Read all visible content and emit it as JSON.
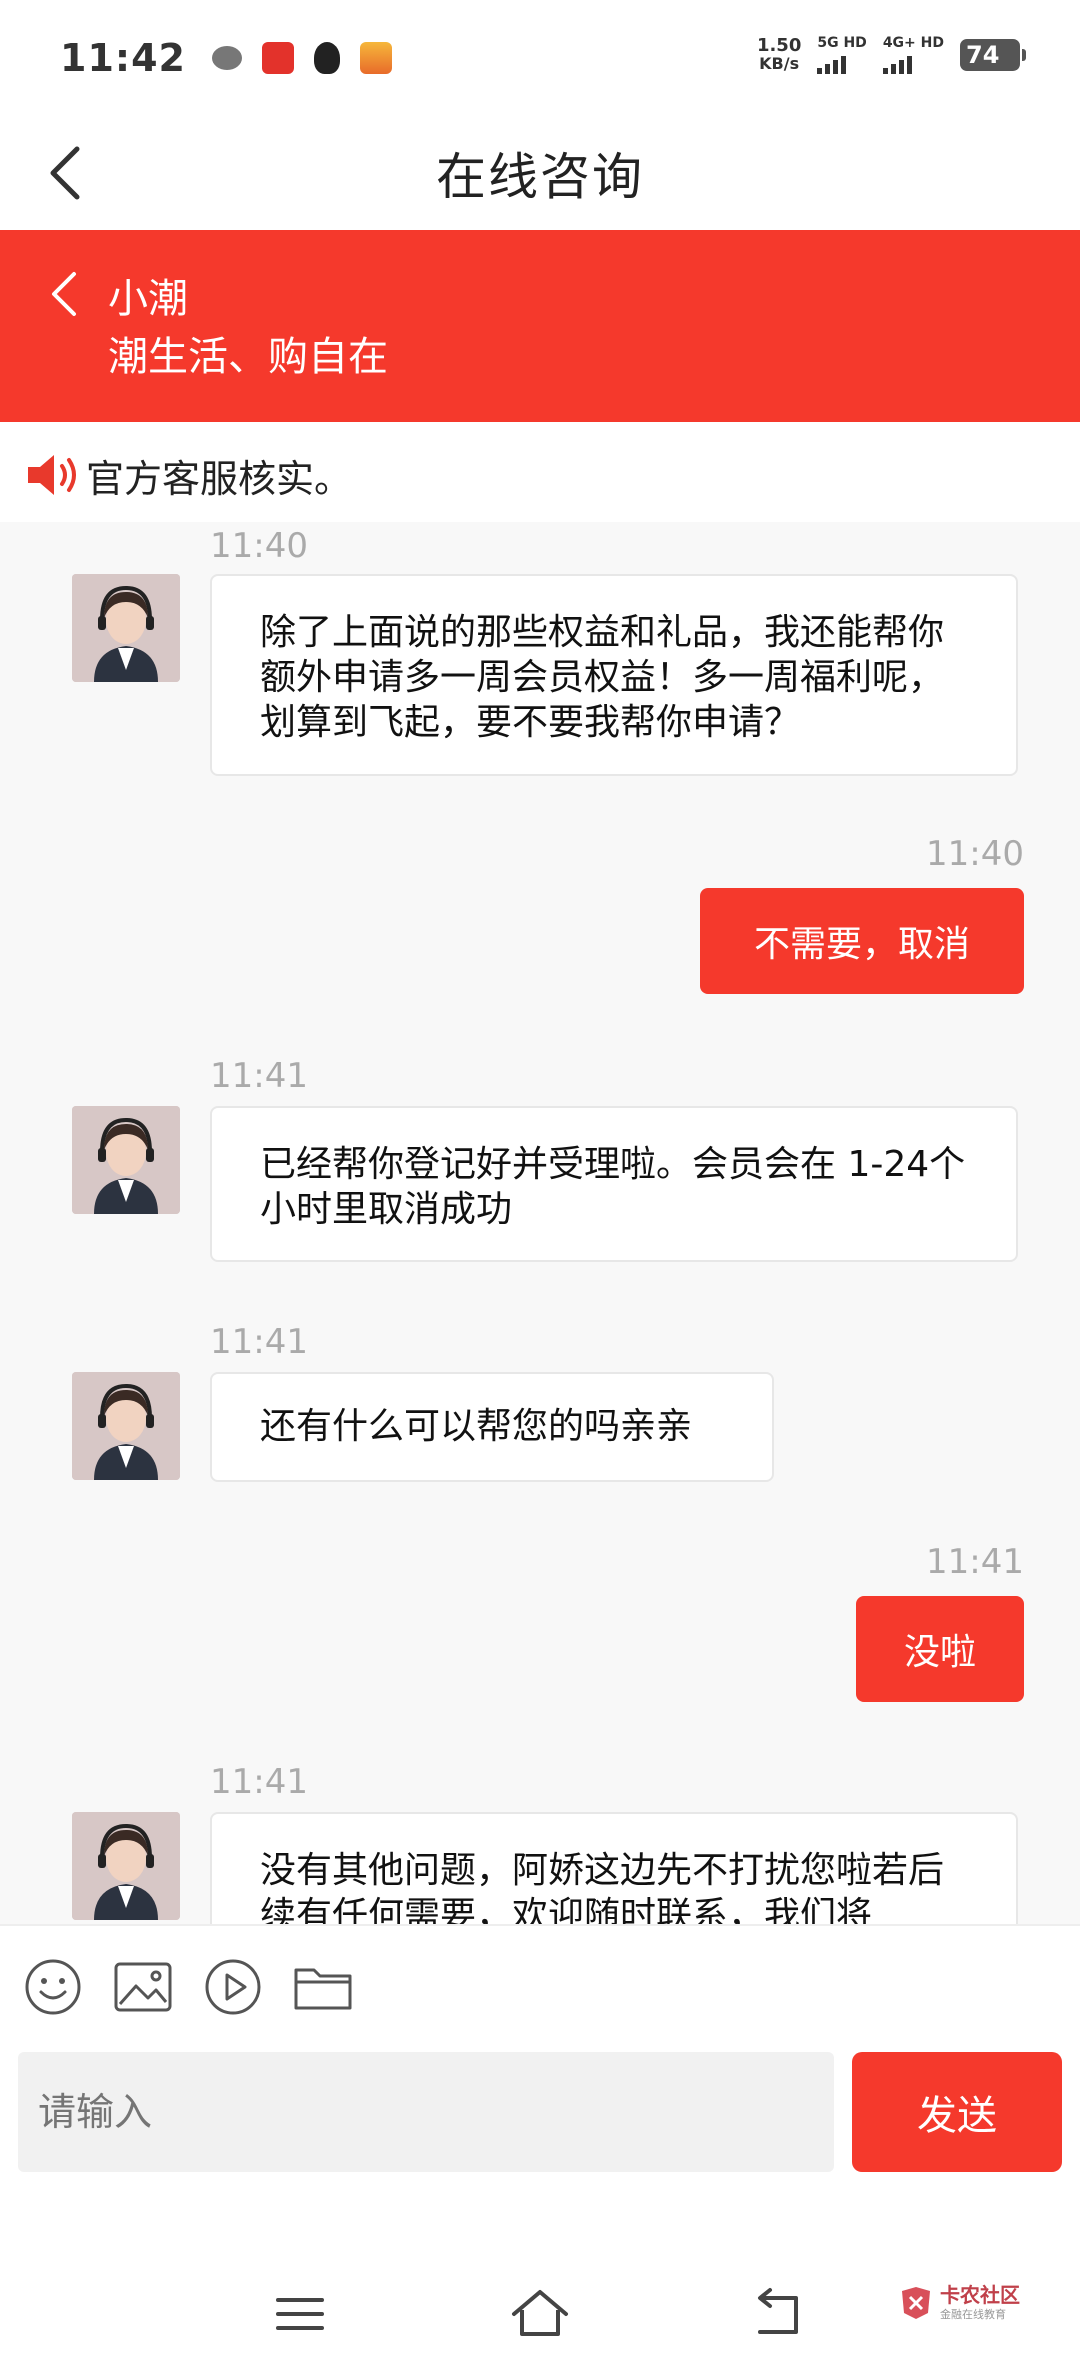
{
  "status_bar": {
    "time": "11:42",
    "net_speed_value": "1.50",
    "net_speed_unit": "KB/s",
    "sim1_label": "5G HD",
    "sim2_label": "4G+ HD",
    "battery": "74"
  },
  "header": {
    "title": "在线咨询"
  },
  "banner": {
    "name": "小潮",
    "slogan": "潮生活、购自在"
  },
  "notice": {
    "text": "官方客服核实。"
  },
  "messages": [
    {
      "time": "11:40",
      "text": "除了上面说的那些权益和礼品，我还能帮你额外申请多一周会员权益！多一周福利呢，划算到飞起，要不要我帮你申请？"
    },
    {
      "time": "11:40",
      "text": "不需要，取消"
    },
    {
      "time": "11:41",
      "text": "已经帮你登记好并受理啦。会员会在 1-24个小时里取消成功"
    },
    {
      "time": "11:41",
      "text": "还有什么可以帮您的吗亲亲"
    },
    {
      "time": "11:41",
      "text": "没啦"
    },
    {
      "time": "11:41",
      "text": "没有其他问题，阿娇这边先不打扰您啦若后续有任何需要，欢迎随时联系，我们将"
    }
  ],
  "input": {
    "placeholder": "请输入",
    "send_label": "发送"
  },
  "watermark": {
    "brand": "卡农社区",
    "sub": "金融在线教育"
  },
  "colors": {
    "accent": "#f5392c",
    "chat_bg": "#f8f8f8"
  }
}
